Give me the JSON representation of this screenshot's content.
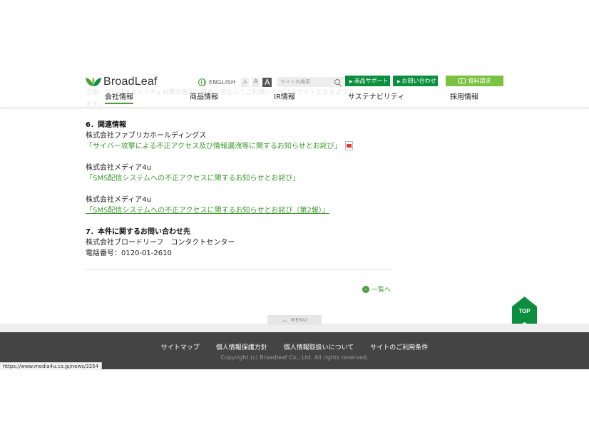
{
  "header": {
    "logo_text": "BroadLeaf",
    "english_label": "ENGLISH",
    "font_small": "A",
    "font_medium": "A",
    "font_large": "A",
    "search_placeholder": "サイト内検索",
    "support_button": "商品サポート",
    "contact_button": "お問い合わせ",
    "document_button": "資料請求",
    "nav": [
      "会社情報",
      "商品情報",
      "IR情報",
      "サステナビリティ",
      "採用情報"
    ],
    "behind_text_1": "今後、当社はセキュリティ対策の強化に努め、安心してご利用いただけるサイトとなるよう",
    "behind_text_2": "ます。"
  },
  "content": {
    "section6_heading": "6．関連情報",
    "item1_company": "株式会社ファブリカホールディングス",
    "item1_link": "「サイバー攻撃による不正アクセス及び情報漏洩等に関するお知らせとお詫び」",
    "item2_company": "株式会社メディア4u",
    "item2_link": "「SMS配信システムへの不正アクセスに関するお知らせとお詫び」",
    "item3_company": "株式会社メディア4u",
    "item3_link": "「SMS配信システムへの不正アクセスに関するお知らせとお詫び（第2報）」",
    "section7_heading": "7．本件に関するお問い合わせ先",
    "contact_company": "株式会社ブロードリーフ　コンタクトセンター",
    "contact_phone": "電話番号：0120-01-2610",
    "back_link": "一覧へ"
  },
  "footer": {
    "menu_tab": "MENU",
    "links": [
      "サイトマップ",
      "個人情報保護方針",
      "個人情報取扱いについて",
      "サイトのご利用条件"
    ],
    "copyright": "Copyright (c) Broadleaf Co., Ltd. All rights reserved.",
    "top_button": "TOP"
  },
  "status_bar_url": "https://www.media4u.co.jp/news/3354",
  "colors": {
    "brand_green": "#0b8f3e",
    "light_green": "#7cc242",
    "link_green": "#3e9a2f",
    "footer_bg": "#444444"
  }
}
